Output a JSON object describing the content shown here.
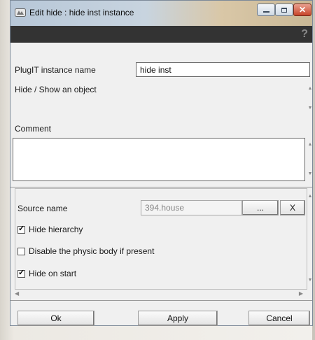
{
  "window": {
    "title": "Edit hide : hide inst instance"
  },
  "toolbar": {
    "help_glyph": "?"
  },
  "form": {
    "instance_label": "PlugIT instance name",
    "instance_value": "hide inst",
    "description": "Hide / Show an object",
    "comment_label": "Comment",
    "comment_value": ""
  },
  "source": {
    "label": "Source name",
    "value": "394.house",
    "browse_label": "...",
    "clear_label": "X"
  },
  "options": [
    {
      "label": "Hide hierarchy",
      "checked": true
    },
    {
      "label": "Disable the physic body if present",
      "checked": false
    },
    {
      "label": "Hide on start",
      "checked": true
    }
  ],
  "footer": {
    "ok_label": "Ok",
    "apply_label": "Apply",
    "cancel_label": "Cancel"
  }
}
